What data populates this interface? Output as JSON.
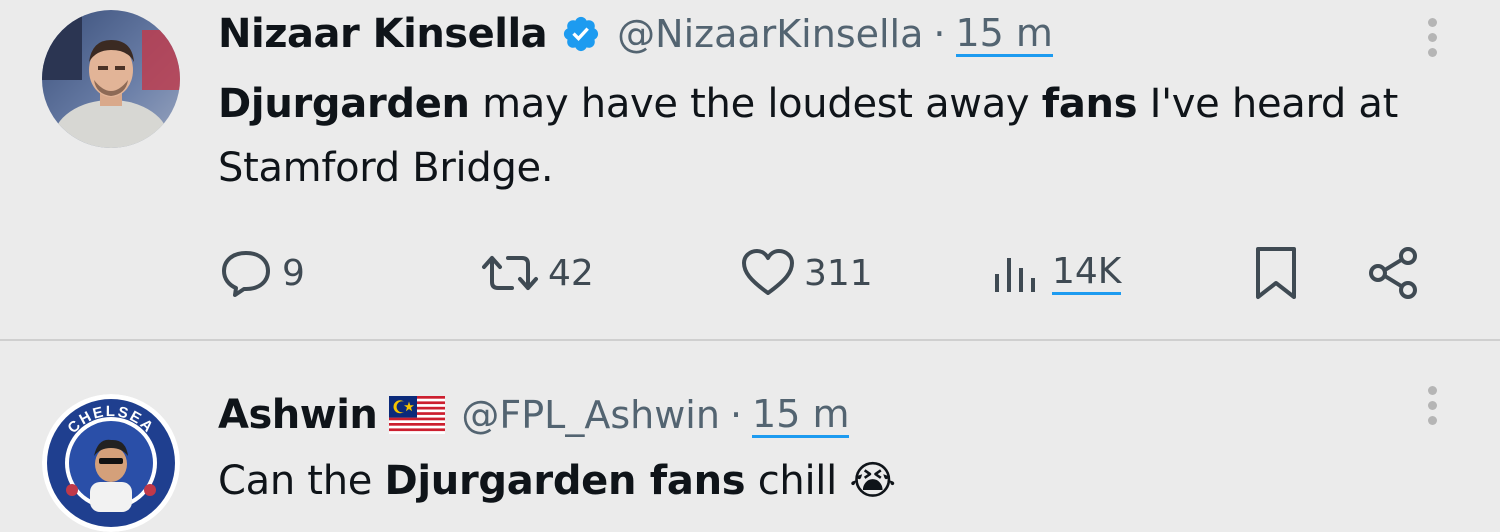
{
  "tweets": [
    {
      "name": "Nizaar Kinsella",
      "handle": "@NizaarKinsella",
      "separator": "·",
      "time": "15 m",
      "verified": true,
      "avatar_icon": "avatar-man-photo",
      "text_segments": [
        {
          "text": "Djurgarden",
          "bold": true
        },
        {
          "text": " may have the loudest away ",
          "bold": false
        },
        {
          "text": "fans",
          "bold": true
        },
        {
          "text": " I've heard at Stamford Bridge.",
          "bold": false
        }
      ],
      "actions": {
        "replies": "9",
        "retweets": "42",
        "likes": "311",
        "views": "14K"
      }
    },
    {
      "name": "Ashwin",
      "handle": "@FPL_Ashwin",
      "separator": "·",
      "time": "15 m",
      "flag_icon": "malaysia-flag-icon",
      "avatar_icon": "chelsea-badge-avatar",
      "avatar_text": "CHELSEA",
      "text_segments": [
        {
          "text": "Can the ",
          "bold": false
        },
        {
          "text": "Djurgarden fans",
          "bold": true
        },
        {
          "text": " chill ",
          "bold": false
        },
        {
          "text": "😭",
          "bold": false,
          "emoji": true
        }
      ]
    }
  ],
  "colors": {
    "background": "#ebebeb",
    "text": "#0f1419",
    "muted": "#536471",
    "accent": "#1d9bf0"
  }
}
